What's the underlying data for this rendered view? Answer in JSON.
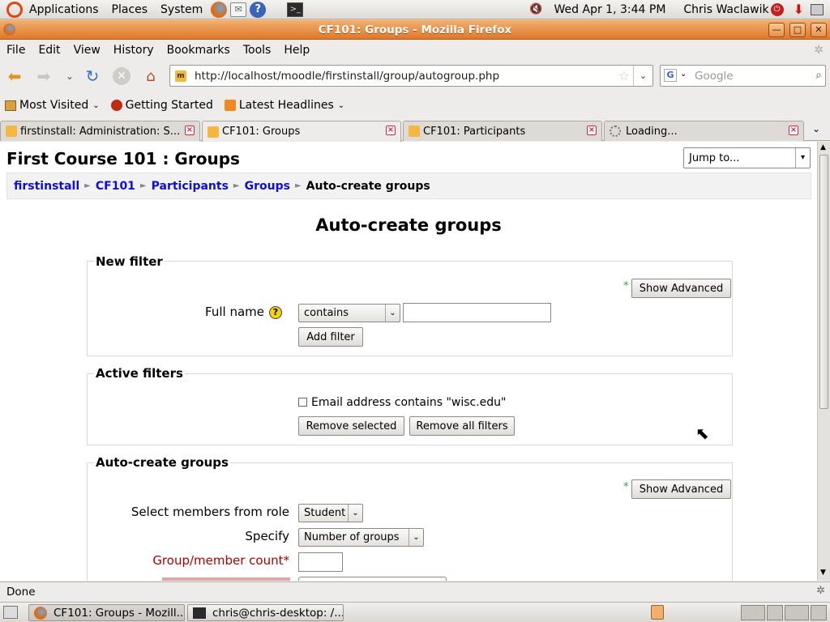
{
  "panel": {
    "menus": [
      "Applications",
      "Places",
      "System"
    ],
    "clock": "Wed Apr  1,  3:44 PM",
    "user": "Chris Waclawik"
  },
  "window": {
    "title": "CF101: Groups - Mozilla Firefox"
  },
  "menubar": {
    "items": [
      "File",
      "Edit",
      "View",
      "History",
      "Bookmarks",
      "Tools",
      "Help"
    ]
  },
  "navbar": {
    "url": "http://localhost/moodle/firstinstall/group/autogroup.php",
    "search_placeholder": "Google"
  },
  "bookmarks": {
    "most_visited": "Most Visited",
    "getting_started": "Getting Started",
    "latest_headlines": "Latest Headlines"
  },
  "tabs": [
    {
      "label": "firstinstall: Administration: S..."
    },
    {
      "label": "CF101: Groups"
    },
    {
      "label": "CF101: Participants"
    },
    {
      "label": "Loading..."
    }
  ],
  "page": {
    "course_title": "First Course 101 : Groups",
    "jump_to": "Jump to...",
    "breadcrumb": [
      "firstinstall",
      "CF101",
      "Participants",
      "Groups",
      "Auto-create groups"
    ],
    "heading": "Auto-create groups",
    "new_filter": {
      "legend": "New filter",
      "show_advanced": "Show Advanced",
      "fullname_label": "Full name",
      "operator": "contains",
      "value": "",
      "add_filter": "Add filter"
    },
    "active_filters": {
      "legend": "Active filters",
      "filter_text": "Email address contains \"wisc.edu\"",
      "remove_selected": "Remove selected",
      "remove_all": "Remove all filters"
    },
    "autocreate": {
      "legend": "Auto-create groups",
      "show_advanced": "Show Advanced",
      "role_label": "Select members from role",
      "role_value": "Student",
      "specify_label": "Specify",
      "specify_value": "Number of groups",
      "count_label": "Group/member count",
      "count_value": "",
      "required_mark": "*"
    }
  },
  "status": {
    "text": "Done"
  },
  "taskbar": {
    "tasks": [
      "CF101: Groups - Mozill...",
      "chris@chris-desktop: /..."
    ]
  },
  "colors": {
    "titlebar": "#e0782a",
    "link": "#1010cc",
    "required": "#aa0000"
  }
}
